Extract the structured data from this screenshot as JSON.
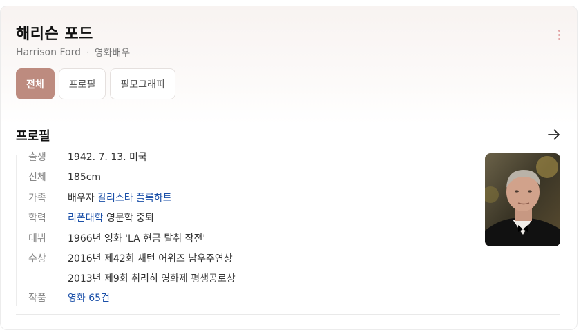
{
  "header": {
    "name": "해리슨 포드",
    "english_name": "Harrison Ford",
    "separator": "·",
    "occupation": "영화배우"
  },
  "tabs": [
    {
      "label": "전체",
      "active": true
    },
    {
      "label": "프로필",
      "active": false
    },
    {
      "label": "필모그래피",
      "active": false
    }
  ],
  "profile": {
    "section_title": "프로필",
    "rows": {
      "birth": {
        "key": "출생",
        "value": "1942. 7. 13. 미국"
      },
      "body": {
        "key": "신체",
        "value": "185cm"
      },
      "family": {
        "key": "가족",
        "prefix": "배우자",
        "link": "칼리스타 플록하트"
      },
      "education": {
        "key": "학력",
        "link": "리폰대학",
        "suffix": "영문학 중퇴"
      },
      "debut": {
        "key": "데뷔",
        "value": "1966년 영화 'LA 현금 탈취 작전'"
      },
      "awards": {
        "key": "수상",
        "line1": "2016년 제42회 새턴 어워즈 남우주연상",
        "line2": "2013년 제9회 취리히 영화제 평생공로상"
      },
      "works": {
        "key": "작품",
        "link": "영화 65건"
      }
    }
  },
  "colors": {
    "accent": "#bd8b7f",
    "link": "#1a4fa8",
    "more_dots": "#e2a4a4"
  },
  "icons": {
    "more": "more-vertical-icon",
    "arrow": "arrow-right-icon"
  }
}
